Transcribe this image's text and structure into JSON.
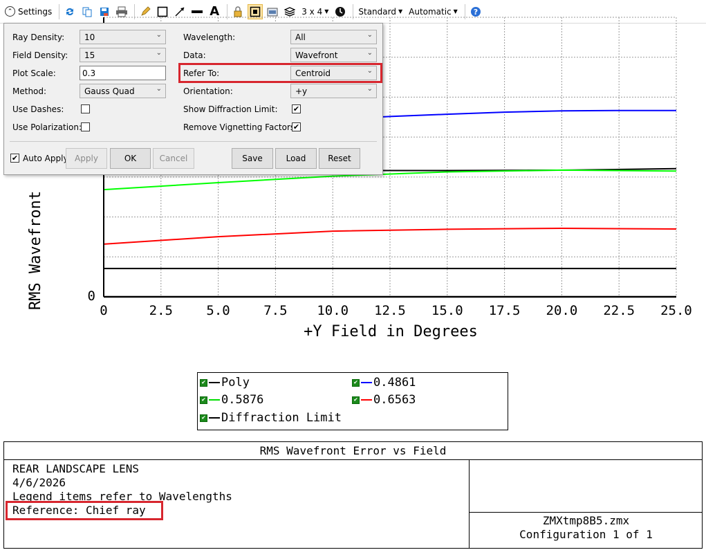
{
  "toolbar": {
    "settings_label": "Settings",
    "layout_label": "3 x 4",
    "standard_label": "Standard",
    "automatic_label": "Automatic",
    "icons": [
      "refresh-icon",
      "copy-icon",
      "save-icon",
      "print-icon",
      "pencil-icon",
      "rectangle-icon",
      "arrow-icon",
      "line-icon",
      "text-icon",
      "lock-icon",
      "fit-icon",
      "export-icon",
      "layers-icon",
      "clock-icon",
      "help-icon"
    ]
  },
  "settings": {
    "ray_density_label": "Ray Density:",
    "ray_density_value": "10",
    "field_density_label": "Field Density:",
    "field_density_value": "15",
    "plot_scale_label": "Plot Scale:",
    "plot_scale_value": "0.3",
    "method_label": "Method:",
    "method_value": "Gauss Quad",
    "use_dashes_label": "Use Dashes:",
    "use_dashes_checked": false,
    "use_polarization_label": "Use Polarization:",
    "use_polarization_checked": false,
    "wavelength_label": "Wavelength:",
    "wavelength_value": "All",
    "data_label": "Data:",
    "data_value": "Wavefront",
    "refer_to_label": "Refer To:",
    "refer_to_value": "Centroid",
    "orientation_label": "Orientation:",
    "orientation_value": "+y",
    "show_diffraction_label": "Show Diffraction Limit:",
    "show_diffraction_checked": true,
    "remove_vignetting_label": "Remove Vignetting Factors:",
    "remove_vignetting_checked": true,
    "auto_apply_label": "Auto Apply",
    "auto_apply_checked": true,
    "apply_label": "Apply",
    "ok_label": "OK",
    "cancel_label": "Cancel",
    "save_label": "Save",
    "load_label": "Load",
    "reset_label": "Reset"
  },
  "chart_data": {
    "type": "line",
    "title": "",
    "xlabel": "+Y Field in Degrees",
    "ylabel": "RMS Wavefront",
    "xlim": [
      0,
      25
    ],
    "x_ticks": [
      "0",
      "2.5",
      "5.0",
      "7.5",
      "10.0",
      "12.5",
      "15.0",
      "17.5",
      "20.0",
      "22.5",
      "25.0"
    ],
    "y_ticks": [
      "0"
    ],
    "y_scale_note": "y values in units of plot scale (0.3 = full height)",
    "ylim": [
      0,
      0.3
    ],
    "grid": true,
    "series": [
      {
        "name": "Poly",
        "color": "#000000",
        "x": [
          0,
          5,
          10,
          15,
          20,
          25
        ],
        "y": [
          0.1355,
          0.1355,
          0.1355,
          0.1355,
          0.1359,
          0.1375
        ]
      },
      {
        "name": "0.4861",
        "color": "#0000ff",
        "x": [
          0,
          5,
          10,
          12.5,
          15,
          17.5,
          20,
          22.5,
          25
        ],
        "y": [
          0.1655,
          0.1745,
          0.1905,
          0.1935,
          0.196,
          0.1982,
          0.1995,
          0.2,
          0.2
        ]
      },
      {
        "name": "0.5876",
        "color": "#00ff00",
        "x": [
          0,
          5,
          10,
          15,
          20,
          25
        ],
        "y": [
          0.115,
          0.1225,
          0.1295,
          0.134,
          0.136,
          0.135
        ]
      },
      {
        "name": "0.6563",
        "color": "#ff0000",
        "x": [
          0,
          5,
          10,
          15,
          20,
          25
        ],
        "y": [
          0.0565,
          0.0645,
          0.0705,
          0.0725,
          0.0735,
          0.0728
        ]
      },
      {
        "name": "Diffraction Limit",
        "color": "#000000",
        "x": [
          0,
          25
        ],
        "y": [
          0.0304,
          0.0304
        ]
      }
    ]
  },
  "legend": {
    "items": [
      {
        "label": "Poly",
        "color": "#000000"
      },
      {
        "label": "0.4861",
        "color": "#0000ff"
      },
      {
        "label": "0.5876",
        "color": "#00dd00"
      },
      {
        "label": "0.6563",
        "color": "#ff0000"
      },
      {
        "label": "Diffraction Limit",
        "color": "#000000"
      }
    ]
  },
  "info": {
    "title": "RMS Wavefront Error vs Field",
    "lens_name": "REAR LANDSCAPE LENS",
    "date": "4/6/2026",
    "legend_note": "Legend items refer to Wavelengths",
    "reference": "Reference: Chief ray",
    "file_name": "ZMXtmp8B5.zmx",
    "configuration": "Configuration 1 of 1"
  },
  "colors": {
    "highlight": "#d7262e",
    "panel_bg": "#f0f0f0"
  }
}
